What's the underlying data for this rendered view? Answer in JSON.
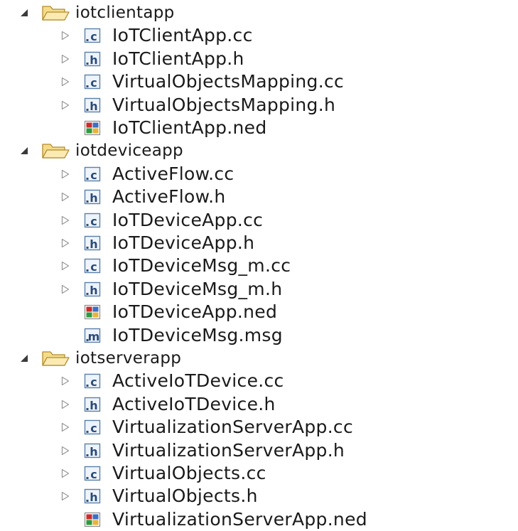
{
  "tree": [
    {
      "name": "iotclientapp",
      "type": "folder",
      "expanded": true,
      "children": [
        {
          "name": "IoTClientApp.cc",
          "icon": "c",
          "expandable": true
        },
        {
          "name": "IoTClientApp.h",
          "icon": "h",
          "expandable": true
        },
        {
          "name": "VirtualObjectsMapping.cc",
          "icon": "c",
          "expandable": true
        },
        {
          "name": "VirtualObjectsMapping.h",
          "icon": "h",
          "expandable": true
        },
        {
          "name": "IoTClientApp.ned",
          "icon": "ned",
          "expandable": false
        }
      ]
    },
    {
      "name": "iotdeviceapp",
      "type": "folder",
      "expanded": true,
      "children": [
        {
          "name": "ActiveFlow.cc",
          "icon": "c",
          "expandable": true
        },
        {
          "name": "ActiveFlow.h",
          "icon": "h",
          "expandable": true
        },
        {
          "name": "IoTDeviceApp.cc",
          "icon": "c",
          "expandable": true
        },
        {
          "name": "IoTDeviceApp.h",
          "icon": "h",
          "expandable": true
        },
        {
          "name": "IoTDeviceMsg_m.cc",
          "icon": "c",
          "expandable": true
        },
        {
          "name": "IoTDeviceMsg_m.h",
          "icon": "h",
          "expandable": true
        },
        {
          "name": "IoTDeviceApp.ned",
          "icon": "ned",
          "expandable": false
        },
        {
          "name": "IoTDeviceMsg.msg",
          "icon": "m",
          "expandable": false
        }
      ]
    },
    {
      "name": "iotserverapp",
      "type": "folder",
      "expanded": true,
      "children": [
        {
          "name": "ActiveIoTDevice.cc",
          "icon": "c",
          "expandable": true
        },
        {
          "name": "ActiveIoTDevice.h",
          "icon": "h",
          "expandable": true
        },
        {
          "name": "VirtualizationServerApp.cc",
          "icon": "c",
          "expandable": true
        },
        {
          "name": "VirtualizationServerApp.h",
          "icon": "h",
          "expandable": true
        },
        {
          "name": "VirtualObjects.cc",
          "icon": "c",
          "expandable": true
        },
        {
          "name": "VirtualObjects.h",
          "icon": "h",
          "expandable": true
        },
        {
          "name": "VirtualizationServerApp.ned",
          "icon": "ned",
          "expandable": false
        }
      ]
    }
  ]
}
